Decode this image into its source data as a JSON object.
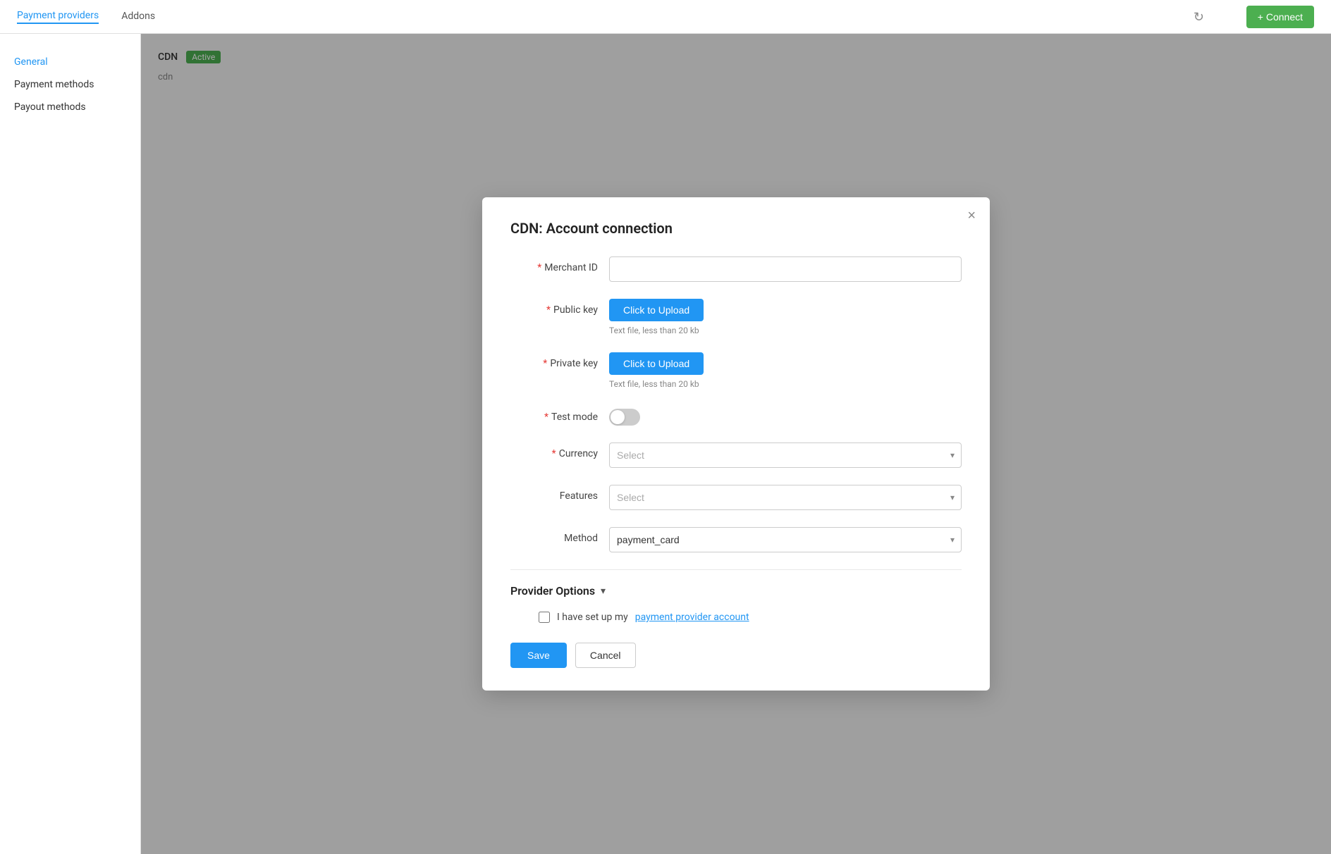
{
  "topNav": {
    "tab1": "Payment providers",
    "tab2": "Addons",
    "connectBtn": "+ Connect"
  },
  "sidebar": {
    "items": [
      {
        "label": "General",
        "active": true
      },
      {
        "label": "Payment methods",
        "active": false
      },
      {
        "label": "Payout methods",
        "active": false
      }
    ]
  },
  "content": {
    "cdnLabel": "CDN",
    "activeBadge": "Active",
    "cdnSub": "cdn"
  },
  "modal": {
    "title": "CDN: Account connection",
    "fields": {
      "merchantId": {
        "label": "Merchant ID",
        "placeholder": "",
        "value": ""
      },
      "publicKey": {
        "label": "Public key",
        "uploadBtn": "Click to Upload",
        "hint": "Text file, less than 20 kb"
      },
      "privateKey": {
        "label": "Private key",
        "uploadBtn": "Click to Upload",
        "hint": "Text file, less than 20 kb"
      },
      "testMode": {
        "label": "Test mode"
      },
      "currency": {
        "label": "Currency",
        "placeholder": "Select",
        "value": ""
      },
      "features": {
        "label": "Features",
        "placeholder": "Select",
        "value": ""
      },
      "method": {
        "label": "Method",
        "placeholder": "payment_card",
        "value": "payment_card"
      }
    },
    "providerOptions": {
      "title": "Provider Options",
      "checkboxLabel": "I have set up my ",
      "checkboxLink": "payment provider account"
    },
    "saveBtn": "Save",
    "cancelBtn": "Cancel"
  }
}
